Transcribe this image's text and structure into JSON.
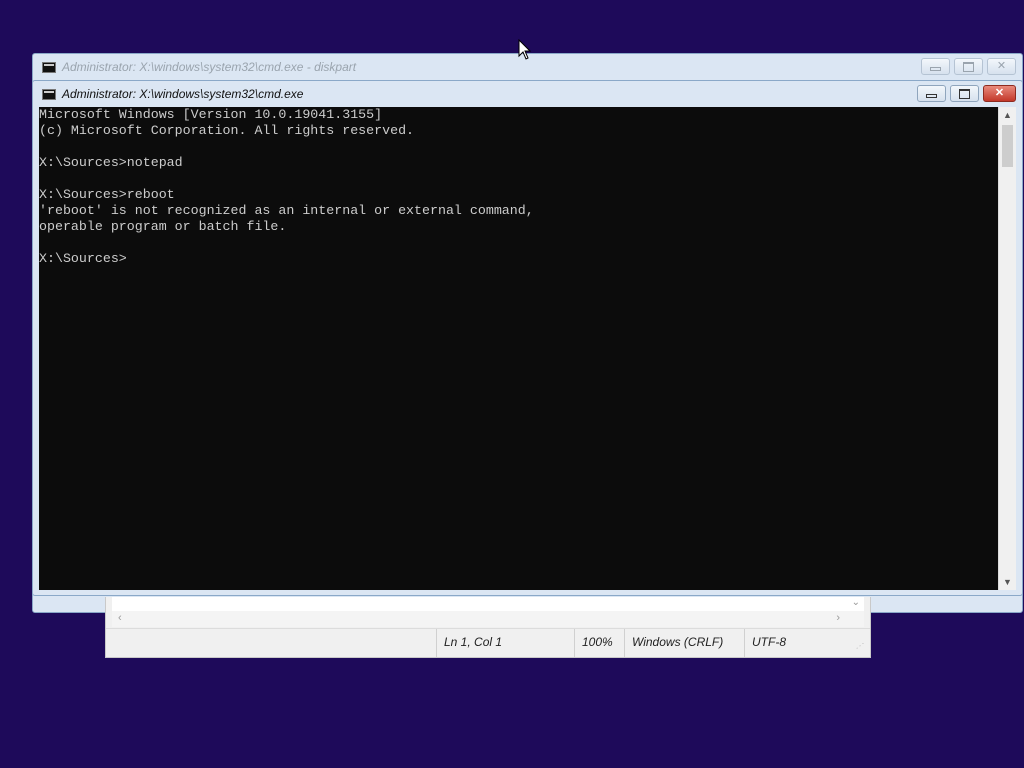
{
  "background_color": "#1e0a5a",
  "windows": {
    "back": {
      "title": "Administrator: X:\\windows\\system32\\cmd.exe - diskpart",
      "buttons": {
        "minimize": "minimize",
        "maximize": "maximize",
        "close": "✕"
      }
    },
    "front": {
      "title": "Administrator: X:\\windows\\system32\\cmd.exe",
      "buttons": {
        "minimize": "minimize",
        "maximize": "maximize",
        "close": "✕"
      },
      "console_lines": [
        "Microsoft Windows [Version 10.0.19041.3155]",
        "(c) Microsoft Corporation. All rights reserved.",
        "",
        "X:\\Sources>notepad",
        "",
        "X:\\Sources>reboot",
        "'reboot' is not recognized as an internal or external command,",
        "operable program or batch file.",
        "",
        "X:\\Sources>"
      ],
      "scroll_up": "▲",
      "scroll_down": "▼"
    }
  },
  "notepad": {
    "status": {
      "position": "Ln 1, Col 1",
      "zoom": "100%",
      "line_endings": "Windows (CRLF)",
      "encoding": "UTF-8"
    },
    "scroll_left": "‹",
    "scroll_right": "›",
    "chevron": "⌄"
  }
}
